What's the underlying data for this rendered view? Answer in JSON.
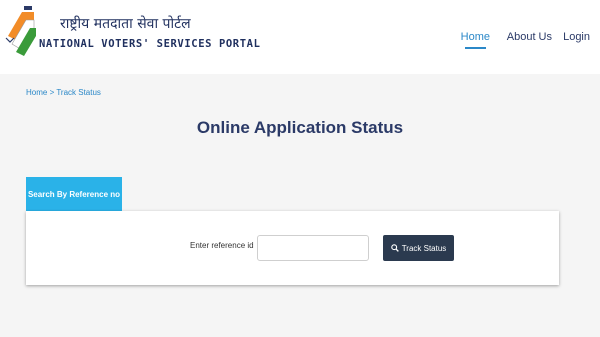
{
  "header": {
    "logo": {
      "hindi_text": "राष्ट्रीय मतदाता सेवा पोर्टल",
      "english_text": "NATIONAL VOTERS' SERVICES PORTAL"
    },
    "nav": [
      {
        "label": "Home",
        "active": true
      },
      {
        "label": "About Us",
        "active": false
      },
      {
        "label": "Login",
        "active": false
      }
    ]
  },
  "breadcrumb": "Home > Track Status",
  "page_title": "Online Application Status",
  "tab_label": "Search By Reference no",
  "form": {
    "reference_label": "Enter reference id",
    "reference_value": "",
    "reference_placeholder": "",
    "button_label": "Track Status"
  },
  "colors": {
    "accent": "#2ab2e8",
    "nav_active": "#2b88c8",
    "title": "#2b3a67",
    "button": "#2b3a4f"
  },
  "icons": [
    "logo-mark-icon",
    "search-icon"
  ]
}
